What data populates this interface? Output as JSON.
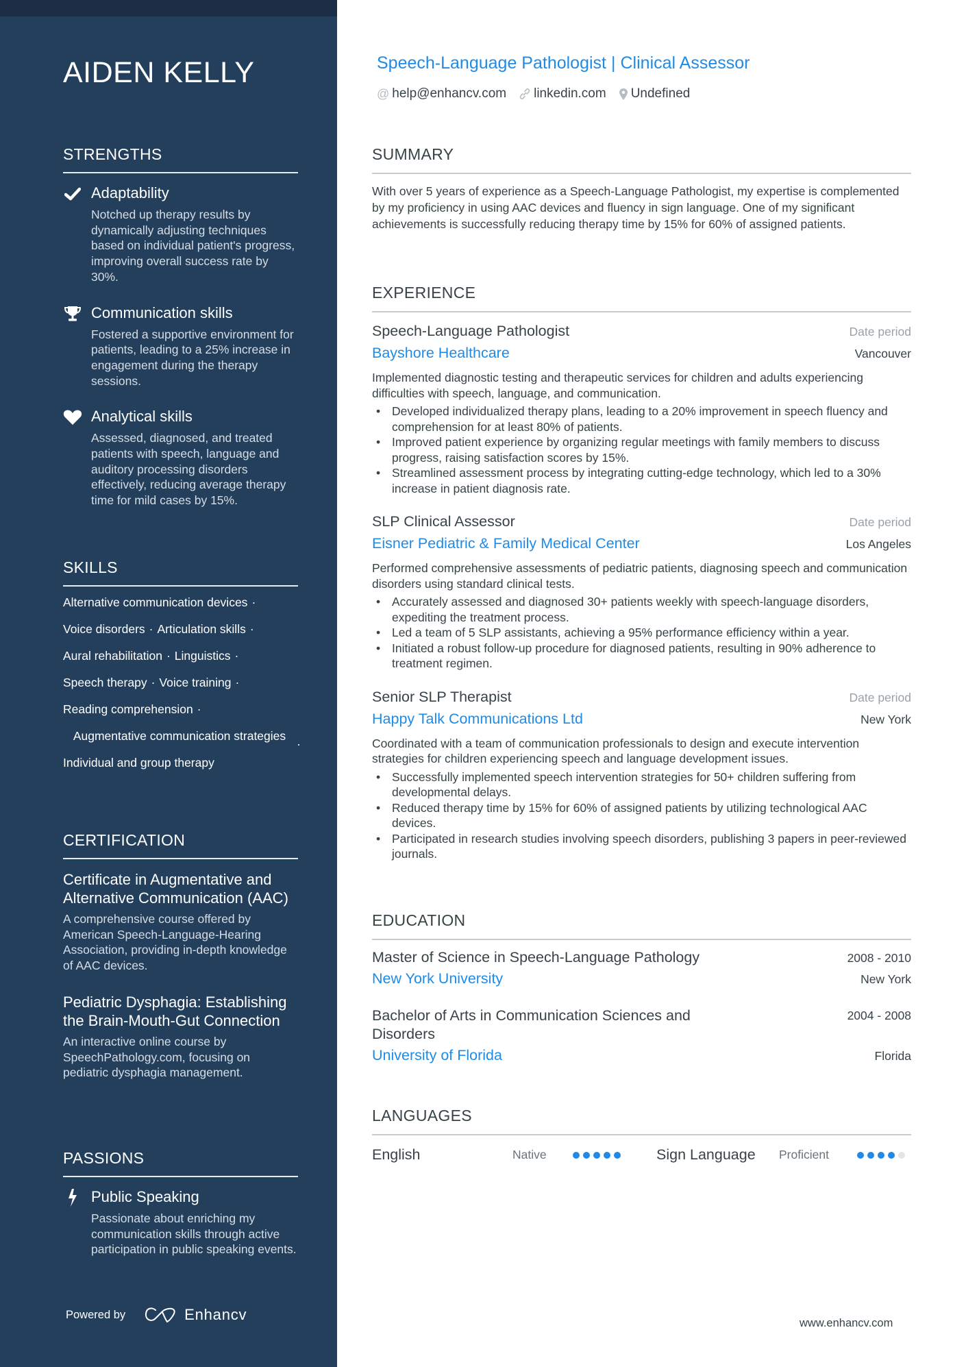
{
  "person": {
    "name": "AIDEN KELLY",
    "headline_parts": [
      "Speech-Language Pathologist",
      "Clinical Assessor"
    ],
    "headline_separator": "|",
    "contacts": [
      {
        "icon": "at-icon",
        "text": "help@enhancv.com"
      },
      {
        "icon": "link-icon",
        "text": "linkedin.com"
      },
      {
        "icon": "location-pin-icon",
        "text": "Undefined"
      }
    ]
  },
  "sidebar": {
    "strengths": {
      "title": "STRENGTHS",
      "items": [
        {
          "icon": "checkmark-icon",
          "title": "Adaptability",
          "description": "Notched up therapy results by dynamically adjusting techniques based on individual patient's progress, improving overall success rate by 30%."
        },
        {
          "icon": "trophy-icon",
          "title": "Communication skills",
          "description": "Fostered a supportive environment for patients, leading to a 25% increase in engagement during the therapy sessions."
        },
        {
          "icon": "heart-icon",
          "title": "Analytical skills",
          "description": "Assessed, diagnosed, and treated patients with speech, language and auditory processing disorders effectively, reducing average therapy time for mild cases by 15%."
        }
      ]
    },
    "skills": {
      "title": "SKILLS",
      "separator": "·",
      "rows": [
        [
          "Alternative communication devices"
        ],
        [
          "Voice disorders",
          "Articulation skills"
        ],
        [
          "Aural rehabilitation",
          "Linguistics"
        ],
        [
          "Speech therapy",
          "Voice training"
        ],
        [
          "Reading comprehension"
        ],
        [
          "Augmentative communication strategies"
        ],
        [
          "Individual and group therapy"
        ]
      ]
    },
    "certification": {
      "title": "CERTIFICATION",
      "items": [
        {
          "title": "Certificate in Augmentative and Alternative Communication (AAC)",
          "description": "A comprehensive course offered by American Speech-Language-Hearing Association, providing in-depth knowledge of AAC devices."
        },
        {
          "title": "Pediatric Dysphagia: Establishing the Brain-Mouth-Gut Connection",
          "description": "An interactive online course by SpeechPathology.com, focusing on pediatric dysphagia management."
        }
      ]
    },
    "passions": {
      "title": "PASSIONS",
      "items": [
        {
          "icon": "lightning-bolt-icon",
          "title": "Public Speaking",
          "description": "Passionate about enriching my communication skills through active participation in public speaking events."
        }
      ]
    },
    "powered_by": {
      "label": "Powered by",
      "brand": "Enhancv"
    }
  },
  "main": {
    "summary": {
      "title": "SUMMARY",
      "text": "With over 5 years of experience as a Speech-Language Pathologist, my expertise is complemented by my proficiency in using AAC devices and fluency in sign language. One of my significant achievements is successfully reducing therapy time by 15% for 60% of assigned patients."
    },
    "experience": {
      "title": "EXPERIENCE",
      "jobs": [
        {
          "title": "Speech-Language Pathologist",
          "date": "Date period",
          "company": "Bayshore Healthcare",
          "location": "Vancouver",
          "description": "Implemented diagnostic testing and therapeutic services for children and adults experiencing difficulties with speech, language, and communication.",
          "bullets": [
            "Developed individualized therapy plans, leading to a 20% improvement in speech fluency and comprehension for at least 80% of patients.",
            "Improved patient experience by organizing regular meetings with family members to discuss progress, raising satisfaction scores by 15%.",
            "Streamlined assessment process by integrating cutting-edge technology, which led to a 30% increase in patient diagnosis rate."
          ]
        },
        {
          "title": "SLP Clinical Assessor",
          "date": "Date period",
          "company": "Eisner Pediatric & Family Medical Center",
          "location": "Los Angeles",
          "description": "Performed comprehensive assessments of pediatric patients, diagnosing speech and communication disorders using standard clinical tests.",
          "bullets": [
            "Accurately assessed and diagnosed 30+ patients weekly with speech-language disorders, expediting the treatment process.",
            "Led a team of 5 SLP assistants, achieving a 95% performance efficiency within a year.",
            "Initiated a robust follow-up procedure for diagnosed patients, resulting in 90% adherence to treatment regimen."
          ]
        },
        {
          "title": "Senior SLP Therapist",
          "date": "Date period",
          "company": "Happy Talk Communications Ltd",
          "location": "New York",
          "description": "Coordinated with a team of communication professionals to design and execute intervention strategies for children experiencing speech and language development issues.",
          "bullets": [
            "Successfully implemented speech intervention strategies for 50+ children suffering from developmental delays.",
            "Reduced therapy time by 15% for 60% of assigned patients by utilizing technological AAC devices.",
            "Participated in research studies involving speech disorders, publishing 3 papers in peer-reviewed journals."
          ]
        }
      ]
    },
    "education": {
      "title": "EDUCATION",
      "items": [
        {
          "degree": "Master of Science in Speech-Language Pathology",
          "dates": "2008 - 2010",
          "school": "New York University",
          "location": "New York"
        },
        {
          "degree": "Bachelor of Arts in Communication Sciences and Disorders",
          "dates": "2004 - 2008",
          "school": "University of Florida",
          "location": "Florida"
        }
      ]
    },
    "languages": {
      "title": "LANGUAGES",
      "items": [
        {
          "name": "English",
          "level": "Native",
          "rating": 5,
          "max": 5
        },
        {
          "name": "Sign Language",
          "level": "Proficient",
          "rating": 4,
          "max": 5
        }
      ]
    },
    "footer_url": "www.enhancv.com"
  },
  "colors": {
    "sidebar_bg": "#233f5c",
    "sidebar_topbar": "#1b2d44",
    "accent": "#1f8be6",
    "text": "#384347",
    "muted": "#9aa1a6"
  }
}
